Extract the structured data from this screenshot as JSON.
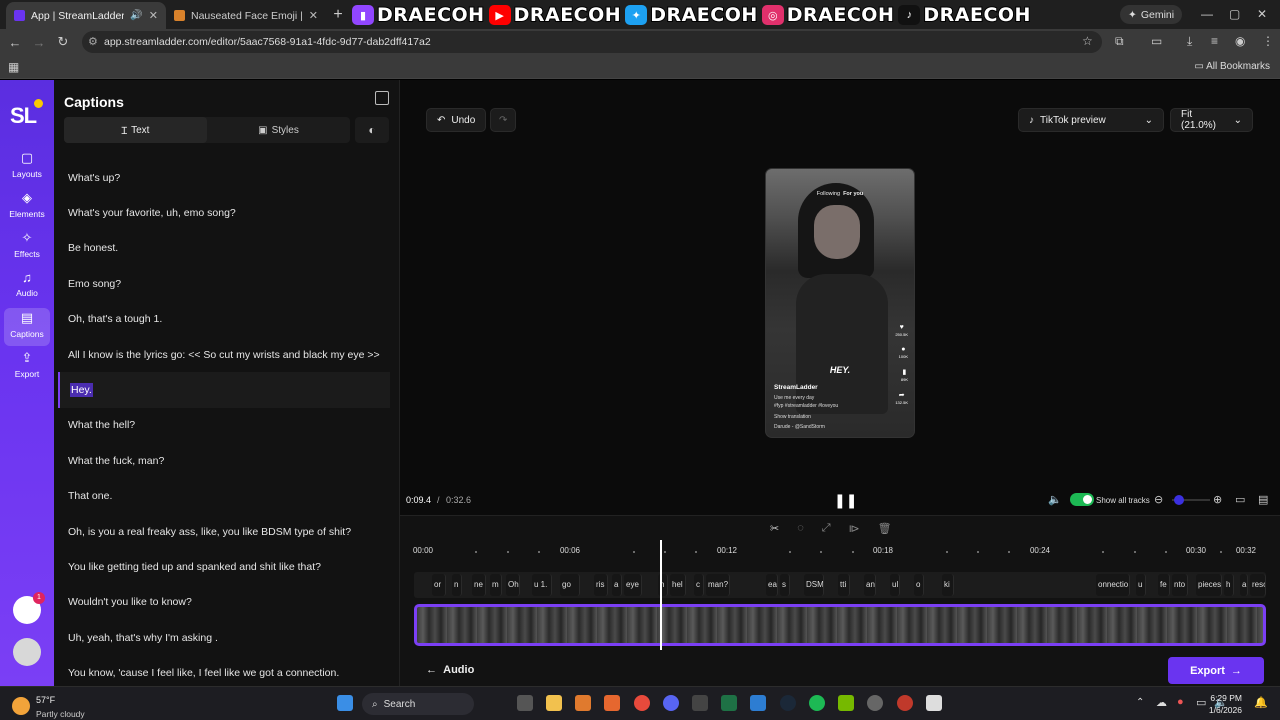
{
  "browser": {
    "tabs": [
      {
        "title": "App | StreamLadder",
        "active": true
      },
      {
        "title": "Nauseated Face Emoji | Me",
        "active": false
      }
    ],
    "url": "app.streamladder.com/editor/5aac7568-91a1-4fdc-9d77-dab2dff417a2",
    "gemini_label": "Gemini",
    "all_bookmarks": "All Bookmarks"
  },
  "banner": {
    "handles": [
      "DRAECOH",
      "DRAECOH",
      "DRAECOH",
      "DRAECOH",
      "DRAECOH"
    ],
    "colors": {
      "twitch": "#9146ff",
      "youtube": "#ff0000",
      "twitter": "#1da1f2",
      "instagram": "#e1306c",
      "tiktok": "#111111"
    }
  },
  "rail": {
    "logo": "SL",
    "items": [
      {
        "label": "Layouts",
        "icon": "layout-icon"
      },
      {
        "label": "Elements",
        "icon": "elements-icon"
      },
      {
        "label": "Effects",
        "icon": "effects-icon"
      },
      {
        "label": "Audio",
        "icon": "audio-icon"
      },
      {
        "label": "Captions",
        "icon": "captions-icon",
        "selected": true
      },
      {
        "label": "Export",
        "icon": "export-icon"
      }
    ],
    "notification_count": "1"
  },
  "panel": {
    "title": "Captions",
    "tab_text": "Text",
    "tab_styles": "Styles",
    "captions": [
      "What's up?",
      "What's your favorite, uh, emo song?",
      "Be honest.",
      "Emo song?",
      "Oh, that's a tough 1.",
      "All I know is the lyrics go: << So cut my wrists and black my eye >>",
      "Hey.",
      "What the hell?",
      "What the fuck, man?",
      "That one.",
      "Oh, is you a real freaky ass, like, you like BDSM type of shit?",
      "You like getting tied up and spanked and shit like that?",
      "Wouldn't you like to know?",
      "Uh, yeah, that's why I'm asking .",
      "You know, 'cause I feel like, I feel like we got a connection."
    ],
    "active_index": 6
  },
  "toolbar": {
    "undo": "Undo",
    "preview": "TikTok preview",
    "zoom": "Fit (21.0%)"
  },
  "phone": {
    "following": "Following",
    "foryou": "For you",
    "overlay_text": "HEY.",
    "user": "StreamLadder",
    "desc": "Use me every day",
    "tags": "#fyp #streamladder #loveyou",
    "translation": "Show translation",
    "sound": "Darude - @SandStorm",
    "likes": "250.5K",
    "comments": "100K",
    "saves": "89K",
    "shares": "132.5K"
  },
  "player": {
    "current": "0:09.4",
    "separator": "/",
    "total": "0:32.6",
    "show_all_tracks": "Show all tracks"
  },
  "timeline": {
    "ticks": [
      "00:00",
      "00:06",
      "00:12",
      "00:18",
      "00:24",
      "00:30",
      "00:32"
    ],
    "chips": [
      "or",
      "n",
      "ne",
      "m",
      "Oh",
      "u 1.",
      "go",
      "ris",
      "a",
      "eye",
      "h",
      "hel",
      "c",
      "man?",
      "ea",
      "s",
      "DSM",
      "tti",
      "ani",
      "ul",
      "o",
      "ki",
      "onnectio",
      "u",
      "fe",
      "nto",
      "pieces",
      "h",
      "a",
      "resor"
    ],
    "audio": "Audio",
    "export": "Export"
  },
  "taskbar": {
    "temp": "57°F",
    "weather": "Partly cloudy",
    "search": "Search",
    "time": "6:29 PM",
    "date": "1/6/2026"
  }
}
